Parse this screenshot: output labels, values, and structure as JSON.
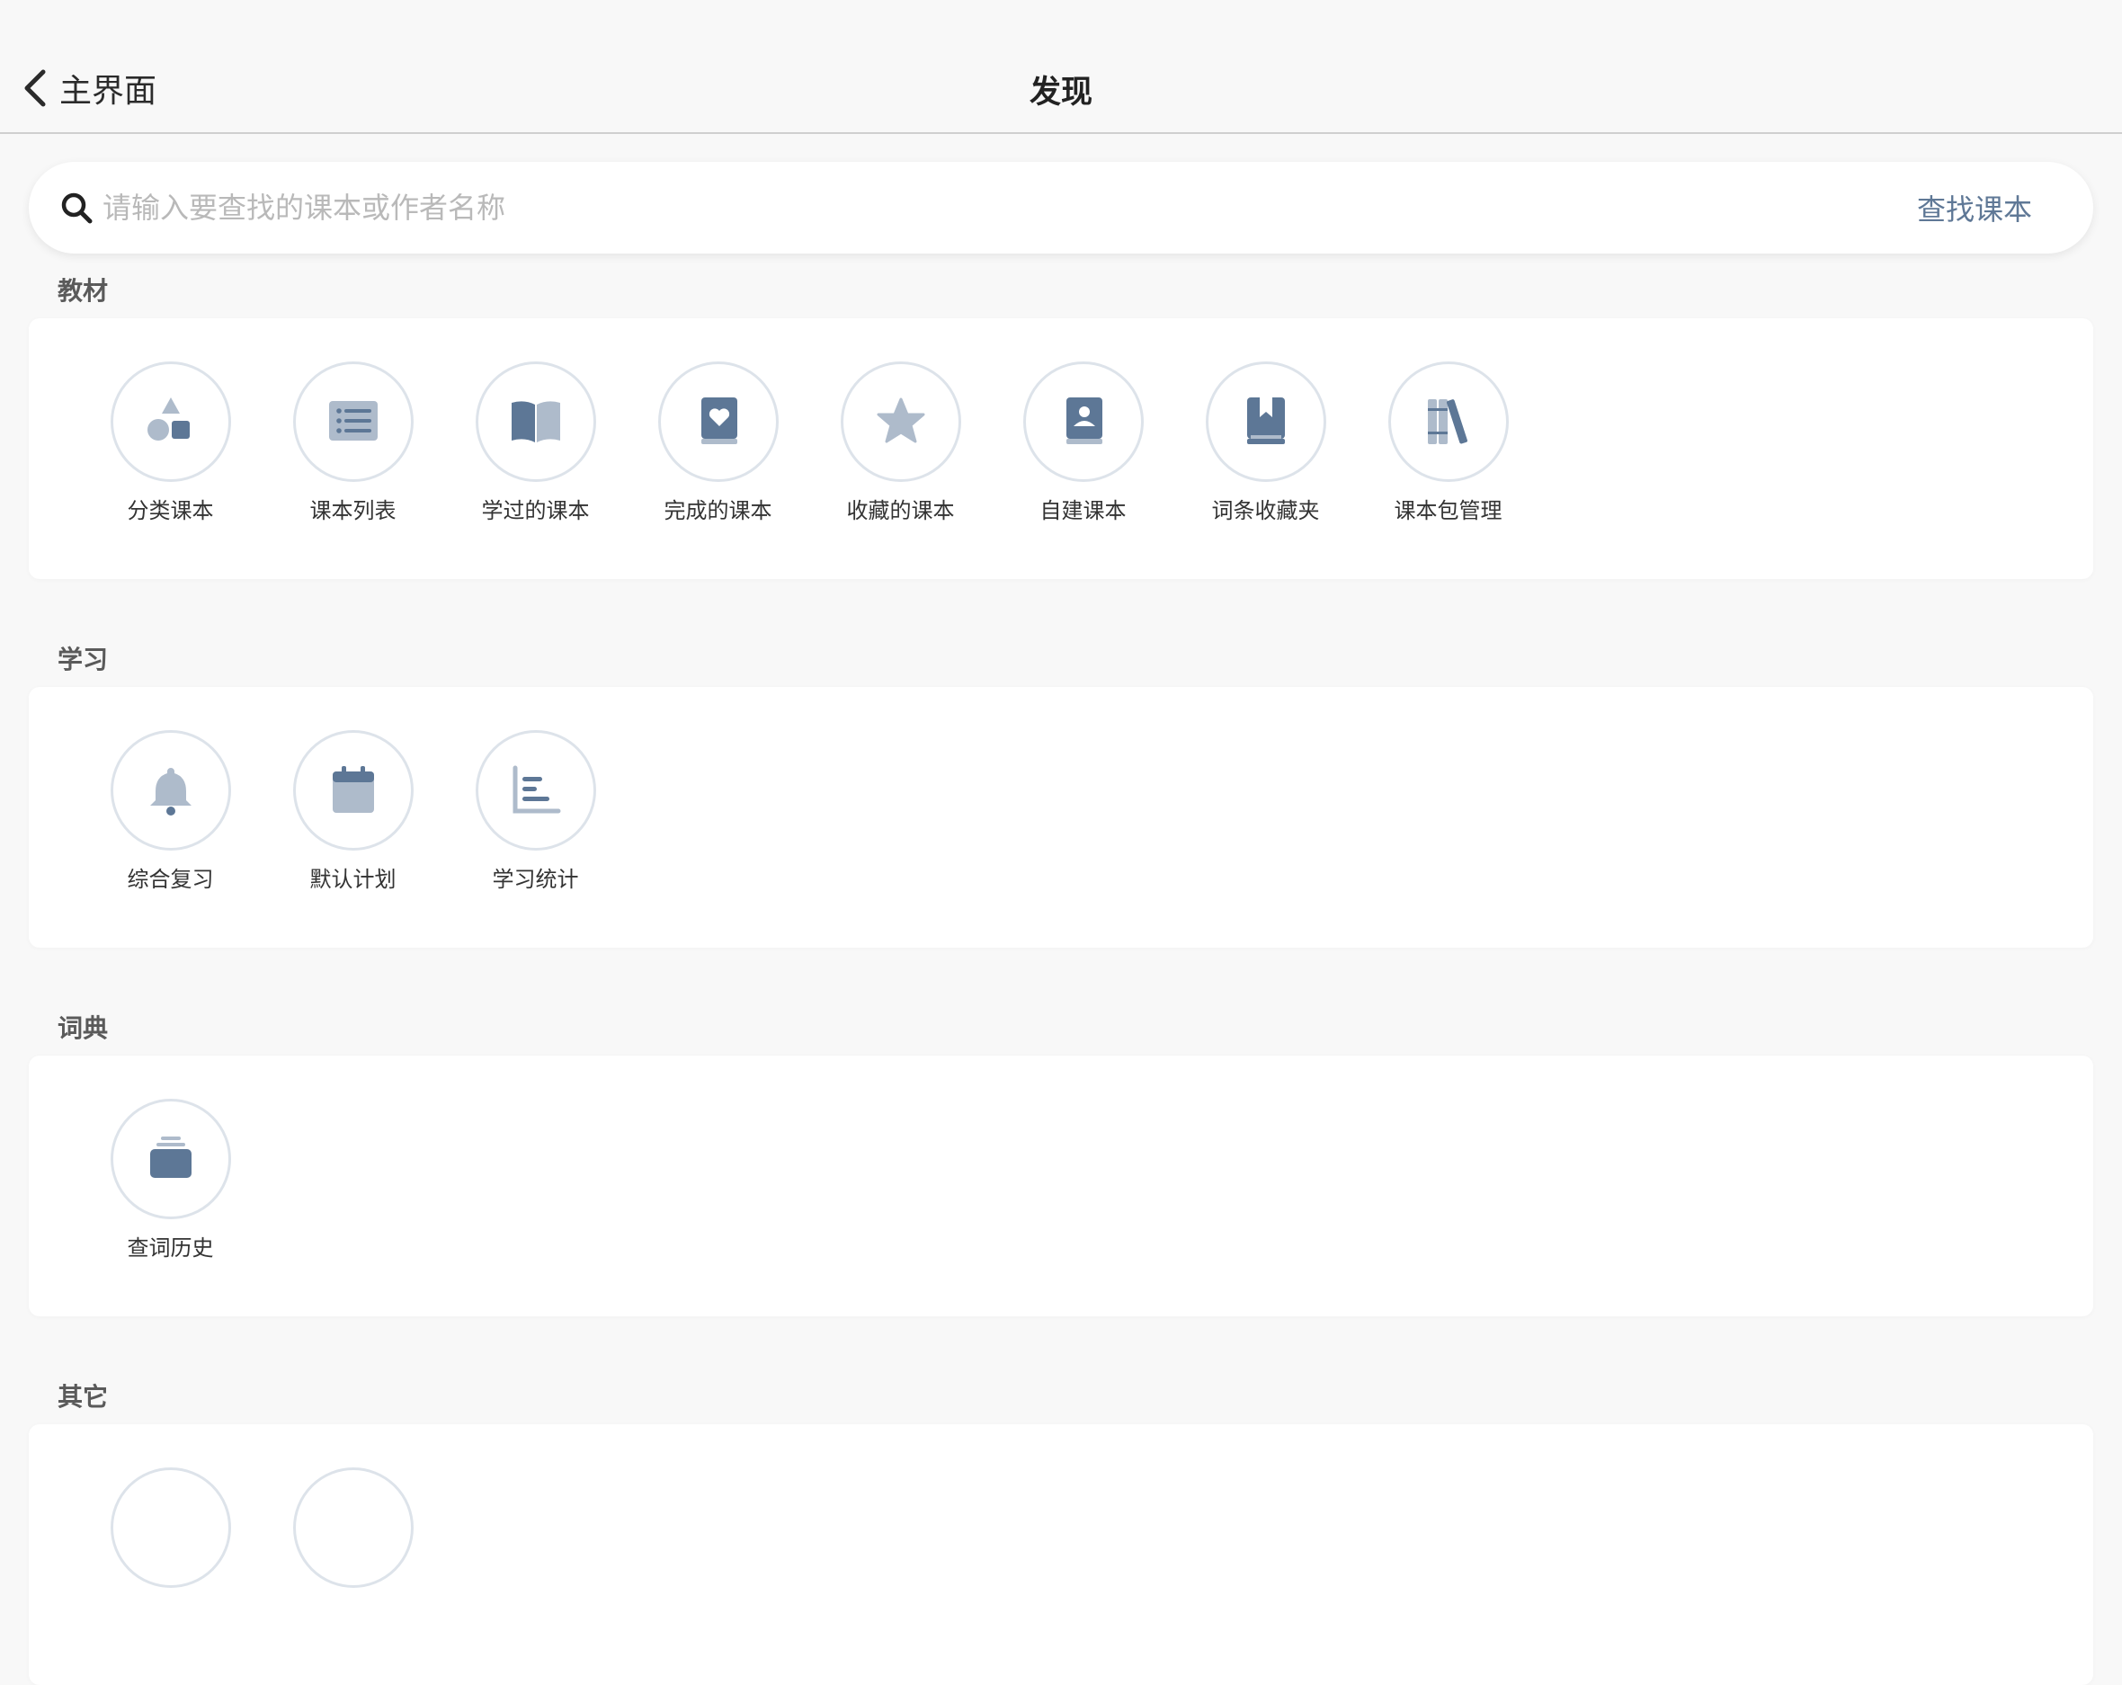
{
  "nav": {
    "back_label": "主界面",
    "title": "发现"
  },
  "search": {
    "placeholder": "请输入要查找的课本或作者名称",
    "button_label": "查找课本"
  },
  "sections": [
    {
      "label": "教材",
      "items": [
        {
          "label": "分类课本",
          "icon": "shapes-icon"
        },
        {
          "label": "课本列表",
          "icon": "list-icon"
        },
        {
          "label": "学过的课本",
          "icon": "open-book-icon"
        },
        {
          "label": "完成的课本",
          "icon": "heart-book-icon"
        },
        {
          "label": "收藏的课本",
          "icon": "star-icon"
        },
        {
          "label": "自建课本",
          "icon": "contact-book-icon"
        },
        {
          "label": "词条收藏夹",
          "icon": "bookmark-book-icon"
        },
        {
          "label": "课本包管理",
          "icon": "books-shelf-icon"
        }
      ]
    },
    {
      "label": "学习",
      "items": [
        {
          "label": "综合复习",
          "icon": "bell-icon"
        },
        {
          "label": "默认计划",
          "icon": "calendar-icon"
        },
        {
          "label": "学习统计",
          "icon": "bar-chart-icon"
        }
      ]
    },
    {
      "label": "词典",
      "items": [
        {
          "label": "查词历史",
          "icon": "history-stack-icon"
        }
      ]
    },
    {
      "label": "其它",
      "items": []
    }
  ],
  "colors": {
    "icon_dark": "#5d7796",
    "icon_light": "#aebbcb",
    "accent": "#5f7896"
  }
}
